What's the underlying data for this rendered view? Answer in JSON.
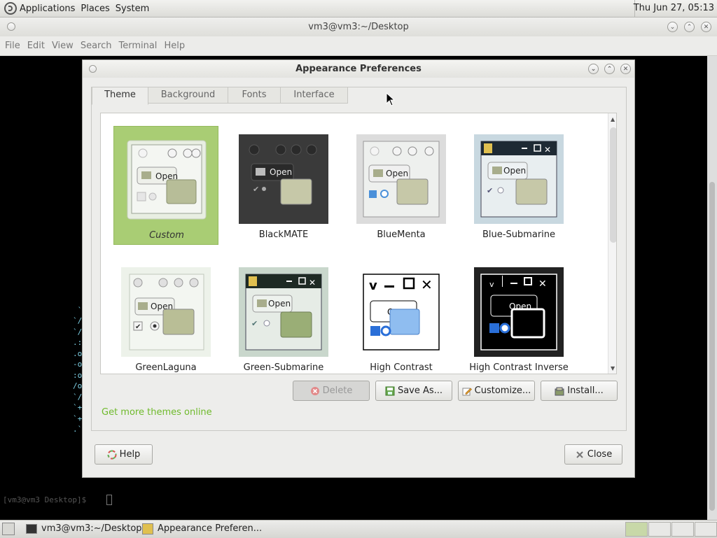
{
  "top_panel": {
    "menus": [
      "Applications",
      "Places",
      "System"
    ],
    "clock": "Thu Jun 27, 05:13"
  },
  "terminal": {
    "title": "vm3@vm3:~/Desktop",
    "menus": [
      "File",
      "Edit",
      "View",
      "Search",
      "Terminal",
      "Help"
    ],
    "prompt": "[vm3@vm3 Desktop]$ "
  },
  "dialog": {
    "title": "Appearance Preferences",
    "tabs": [
      "Theme",
      "Background",
      "Fonts",
      "Interface"
    ],
    "active_tab": "Theme",
    "themes": [
      {
        "name": "Custom",
        "selected": true
      },
      {
        "name": "BlackMATE",
        "selected": false
      },
      {
        "name": "BlueMenta",
        "selected": false
      },
      {
        "name": "Blue-Submarine",
        "selected": false
      },
      {
        "name": "GreenLaguna",
        "selected": false
      },
      {
        "name": "Green-Submarine",
        "selected": false
      },
      {
        "name": "High Contrast",
        "selected": false
      },
      {
        "name": "High Contrast Inverse",
        "selected": false
      }
    ],
    "thumb_open_label": "Open",
    "buttons": {
      "delete": "Delete",
      "save_as": "Save As...",
      "customize": "Customize...",
      "install": "Install..."
    },
    "get_more_link": "Get more themes online",
    "help": "Help",
    "close": "Close"
  },
  "taskbar": {
    "tasks": [
      "vm3@vm3:~/Desktop",
      "Appearance Preferen..."
    ]
  },
  "colors": {
    "selection": "#a9cd74",
    "link": "#6fba2c",
    "ascii_art": "#7fd3e8"
  }
}
